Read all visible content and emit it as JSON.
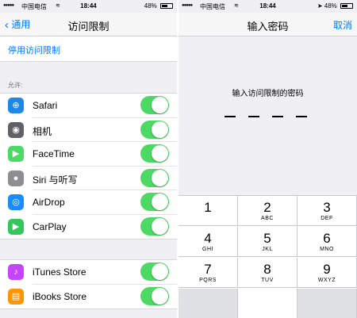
{
  "left": {
    "status": {
      "carrier": "中国电信",
      "time": "18:44",
      "battery_text": "48%",
      "battery_level": 0.48
    },
    "nav": {
      "back_label": "通用",
      "title": "访问限制"
    },
    "disable_label": "停用访问限制",
    "section_header": "允许:",
    "apps": [
      {
        "label": "Safari",
        "icon": "safari-icon",
        "color": "#1e88e5",
        "glyph": "⊕",
        "enabled": true
      },
      {
        "label": "相机",
        "icon": "camera-icon",
        "color": "#5f6166",
        "glyph": "◉",
        "enabled": true
      },
      {
        "label": "FaceTime",
        "icon": "facetime-icon",
        "color": "#4cd964",
        "glyph": "▶",
        "enabled": true
      },
      {
        "label": "Siri 与听写",
        "icon": "siri-icon",
        "color": "#8e8e93",
        "glyph": "●",
        "enabled": true
      },
      {
        "label": "AirDrop",
        "icon": "airdrop-icon",
        "color": "#1a8cff",
        "glyph": "◎",
        "enabled": true
      },
      {
        "label": "CarPlay",
        "icon": "carplay-icon",
        "color": "#34c759",
        "glyph": "▶",
        "enabled": true
      }
    ],
    "stores": [
      {
        "label": "iTunes Store",
        "icon": "itunes-store-icon",
        "color": "#c644fc",
        "glyph": "♪",
        "enabled": true
      },
      {
        "label": "iBooks Store",
        "icon": "ibooks-store-icon",
        "color": "#ff9500",
        "glyph": "▤",
        "enabled": true
      }
    ]
  },
  "right": {
    "status": {
      "carrier": "中国电信",
      "time": "18:44",
      "battery_text": "48%",
      "battery_level": 0.48
    },
    "nav": {
      "title": "输入密码",
      "cancel_label": "取消"
    },
    "prompt": "输入访问限制的密码",
    "keys": [
      {
        "num": "1",
        "letters": ""
      },
      {
        "num": "2",
        "letters": "ABC"
      },
      {
        "num": "3",
        "letters": "DEF"
      },
      {
        "num": "4",
        "letters": "GHI"
      },
      {
        "num": "5",
        "letters": "JKL"
      },
      {
        "num": "6",
        "letters": "MNO"
      },
      {
        "num": "7",
        "letters": "PQRS"
      },
      {
        "num": "8",
        "letters": "TUV"
      },
      {
        "num": "9",
        "letters": "WXYZ"
      }
    ]
  }
}
